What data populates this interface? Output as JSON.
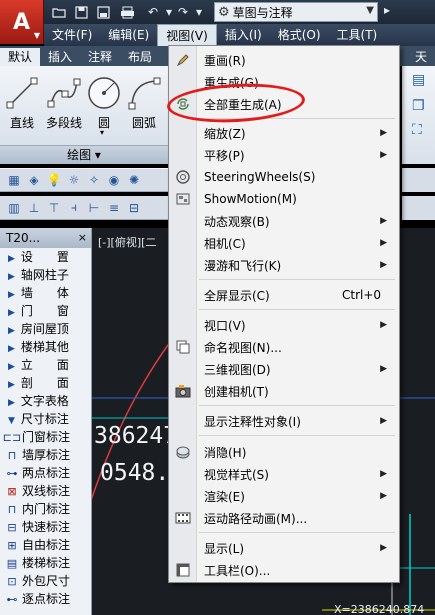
{
  "titlebar": {
    "app_logo": "A",
    "workspace": "草图与注释",
    "workspace_extra": "▸"
  },
  "menubar": {
    "items": [
      "文件(F)",
      "编辑(E)",
      "视图(V)",
      "插入(I)",
      "格式(O)",
      "工具(T)"
    ]
  },
  "ribbon": {
    "tabs": [
      "默认",
      "插入",
      "注释",
      "布局"
    ],
    "tab_extra": "天",
    "tools": [
      "直线",
      "多段线",
      "圆",
      "圆弧"
    ],
    "panel_title": "绘图 ▾"
  },
  "t20": {
    "title": "T20...",
    "close": "×",
    "items": [
      {
        "label": "设　　置"
      },
      {
        "label": "轴网柱子"
      },
      {
        "label": "墙　　体"
      },
      {
        "label": "门　　窗"
      },
      {
        "label": "房间屋顶"
      },
      {
        "label": "楼梯其他"
      },
      {
        "label": "立　　面"
      },
      {
        "label": "剖　　面"
      },
      {
        "label": "文字表格"
      },
      {
        "label": "尺寸标注"
      }
    ],
    "subitems": [
      {
        "label": "门窗标注"
      },
      {
        "label": "墙厚标注"
      },
      {
        "label": "两点标注"
      },
      {
        "label": "双线标注"
      },
      {
        "label": "内门标注"
      },
      {
        "label": "快速标注"
      },
      {
        "label": "自由标注"
      },
      {
        "label": "楼梯标注"
      },
      {
        "label": "外包尺寸"
      },
      {
        "label": "逐点标注"
      }
    ]
  },
  "drawing": {
    "view_label": "[-][俯视][二",
    "coord_a": "386247",
    "coord_b": "0548.",
    "coord_x": "X=2386240.874"
  },
  "view_menu": {
    "items": [
      {
        "label": "重画(R)",
        "icon": "pencil-icon"
      },
      {
        "label": "重生成(G)",
        "icon": ""
      },
      {
        "label": "全部重生成(A)",
        "icon": "regen-all-icon"
      },
      {
        "label": "缩放(Z)",
        "submenu": true
      },
      {
        "label": "平移(P)",
        "submenu": true
      },
      {
        "label": "SteeringWheels(S)",
        "icon": "steering-wheel-icon"
      },
      {
        "label": "ShowMotion(M)",
        "icon": "showmotion-icon"
      },
      {
        "label": "动态观察(B)",
        "submenu": true
      },
      {
        "label": "相机(C)",
        "submenu": true
      },
      {
        "label": "漫游和飞行(K)",
        "submenu": true
      },
      {
        "label": "全屏显示(C)",
        "shortcut": "Ctrl+0"
      },
      {
        "label": "视口(V)",
        "submenu": true
      },
      {
        "label": "命名视图(N)...",
        "icon": "named-view-icon"
      },
      {
        "label": "三维视图(D)",
        "submenu": true
      },
      {
        "label": "创建相机(T)",
        "icon": "camera-icon"
      },
      {
        "label": "显示注释性对象(I)",
        "submenu": true
      },
      {
        "label": "消隐(H)",
        "icon": "hide-icon"
      },
      {
        "label": "视觉样式(S)",
        "submenu": true
      },
      {
        "label": "渲染(E)",
        "submenu": true
      },
      {
        "label": "运动路径动画(M)...",
        "icon": "film-icon"
      },
      {
        "label": "显示(L)",
        "submenu": true
      },
      {
        "label": "工具栏(O)...",
        "icon": "toolbar-icon"
      }
    ]
  }
}
